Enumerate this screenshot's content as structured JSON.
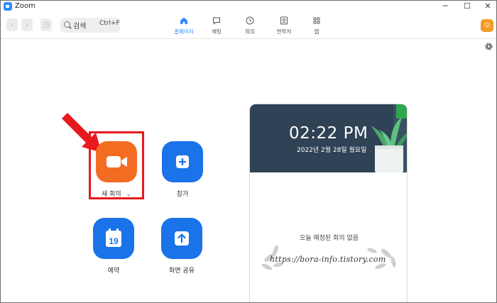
{
  "window": {
    "title": "Zoom",
    "controls": {
      "minimize": "─",
      "maximize": "☐",
      "close": "✕"
    }
  },
  "toolbar": {
    "back_glyph": "‹",
    "forward_glyph": "›",
    "history_glyph": "◷",
    "search": {
      "label": "검색",
      "shortcut": "Ctrl+F"
    },
    "tabs": [
      {
        "label": "홈페이지",
        "icon": "home-icon",
        "active": true
      },
      {
        "label": "채팅",
        "icon": "chat-icon",
        "active": false
      },
      {
        "label": "회의",
        "icon": "clock-icon",
        "active": false
      },
      {
        "label": "연락처",
        "icon": "contacts-icon",
        "active": false
      },
      {
        "label": "앱",
        "icon": "apps-icon",
        "active": false
      }
    ],
    "avatar_glyph": "☺"
  },
  "actions": {
    "new_meeting": {
      "label": "새 회의",
      "chevron": "⌄",
      "icon": "video-camera-icon",
      "color": "#f26d21"
    },
    "join": {
      "label": "참가",
      "icon": "plus-icon",
      "color": "#1a73e8"
    },
    "schedule": {
      "label": "예약",
      "icon": "calendar-icon",
      "calendar_day": "19",
      "color": "#1a73e8"
    },
    "share_screen": {
      "label": "화면 공유",
      "icon": "upload-arrow-icon",
      "color": "#1a73e8"
    }
  },
  "card": {
    "time": "02:22 PM",
    "date": "2022년 2월 28일 월요일",
    "empty_message": "오늘 예정된 회의 없음",
    "watermark": "https://bora-info.tistory.com"
  },
  "colors": {
    "accent": "#2d8cff",
    "highlight": "#e8191d",
    "card_header": "#2f4256"
  }
}
